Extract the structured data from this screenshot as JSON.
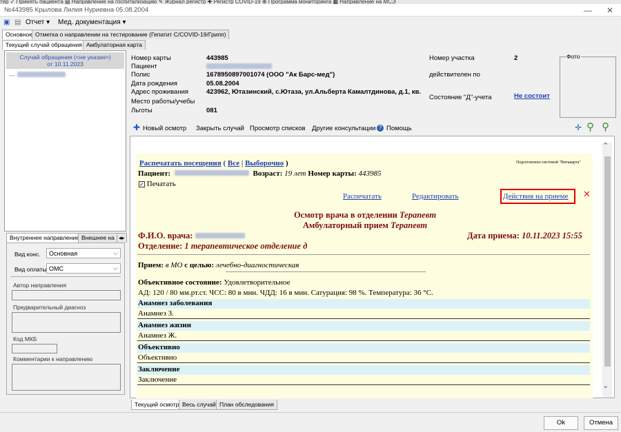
{
  "top_strip": "тер  ✓ Принять пациента  ▤ Направление на госпитализацию  ✎ Журнал регистр  ✚ Регистр COVID-19  ⊕ Программа мониторинга  ▦ Направление на МСЭ",
  "window": {
    "title": "№443985 Крылова Лилия Нуриевна 05.08.2004"
  },
  "menu": {
    "report": "Отчет ▾",
    "med_docs": "Мед. документация ▾"
  },
  "top_tabs": [
    "Основное",
    "Отметка о направлении на тестирование (Гепатит С/COVID-19/Грипп)"
  ],
  "sub_tabs": [
    "Текущий случай обращения",
    "Амбулаторная карта"
  ],
  "case_tree": {
    "item_line1": "Случай обращения (<не указан>)",
    "item_line2": "от 10.11.2023"
  },
  "patient": {
    "card_label": "Номер карты",
    "card_value": "443985",
    "patient_label": "Пациент",
    "policy_label": "Полис",
    "policy_value": "1678950897001074 (ООО \"Ак Барс-мед\")",
    "dob_label": "Дата рождения",
    "dob_value": "05.08.2004",
    "address_label": "Адрес проживания",
    "address_value": "423962, Ютазинский, с.Ютаза, ул.Альберта Камалтдинова, д.1, кв.",
    "work_label": "Место работы/учебы",
    "benefits_label": "Льготы",
    "benefits_value": "081",
    "district_label": "Номер участка",
    "district_value": "2",
    "valid_label": "действителен по",
    "dstatus_label": "Состояние \"Д\"-учета",
    "dstatus_value": "Не состоит",
    "photo_label": "Фото"
  },
  "toolbar": {
    "new_exam": "Новый осмотр",
    "close_case": "Закрыть случай",
    "view_lists": "Просмотр списков",
    "other_consult": "Другие консультации",
    "help": "Помощь"
  },
  "doc": {
    "print_visits": "Распечатать посещения",
    "all": "Все",
    "selective": "Выборочно",
    "prepared_by": "Подготовлено системой \"Витакарта\"",
    "patient_label": "Пациент:",
    "age_label": "Возраст:",
    "age_value": "19 лет",
    "card_label": "Номер карты:",
    "card_value": "443985",
    "print_check": "Печатать",
    "print_link": "Распечатать",
    "edit_link": "Редактировать",
    "actions_link": "Действия на приеме",
    "heading1": "Осмотр врача в отделении",
    "heading1_spec": "Терапевт",
    "heading2": "Амбулаторный прием",
    "heading2_spec": "Терапевт",
    "doctor_label": "Ф.И.О. врача:",
    "date_label": "Дата приема:",
    "date_value": "10.11.2023 15:55",
    "dept_label": "Отделение:",
    "dept_value": "1 терапевтическое отделение д",
    "reception_label": "Прием:",
    "reception_mo": "в МО",
    "reception_purpose_label": "с целью:",
    "reception_purpose": "лечебно-диагностическая",
    "objective_label": "Объективное состояние:",
    "objective_value": "Удовлетворительное",
    "vitals": "АД: 120 / 80 мм.рт.ст. ЧСС: 80 в мин. ЧДД: 16 в мин. Сатурация: 98 %. Температура: 36 °С.",
    "sections": [
      {
        "title": "Анамнез заболевания",
        "value": "Анамнез З."
      },
      {
        "title": "Анамнез жизни",
        "value": "Анамнез Ж."
      },
      {
        "title": "Объективно",
        "value": "Объективно"
      },
      {
        "title": "Заключение",
        "value": "Заключение"
      }
    ]
  },
  "referral": {
    "tabs": [
      "Внутреннее направление",
      "Внешнее на"
    ],
    "kind_label": "Вид конс.",
    "kind_value": "Основная",
    "pay_label": "Вид оплаты",
    "pay_value": "ОМС",
    "author_label": "Автор направления",
    "prelim_label": "Предварительный диагноз",
    "mkb_label": "Код МКБ",
    "comments_label": "Комментарии к направлению"
  },
  "bottom_tabs": [
    "Текущий осмотр",
    "Весь случай",
    "План обследования"
  ],
  "buttons": {
    "ok": "Ok",
    "cancel": "Отмена"
  },
  "colors": {
    "link": "#1a3fb0",
    "doc_bg": "#fffde0",
    "section_bg": "#dcf2f8",
    "heading": "#7a1010",
    "highlight": "#e00000"
  }
}
